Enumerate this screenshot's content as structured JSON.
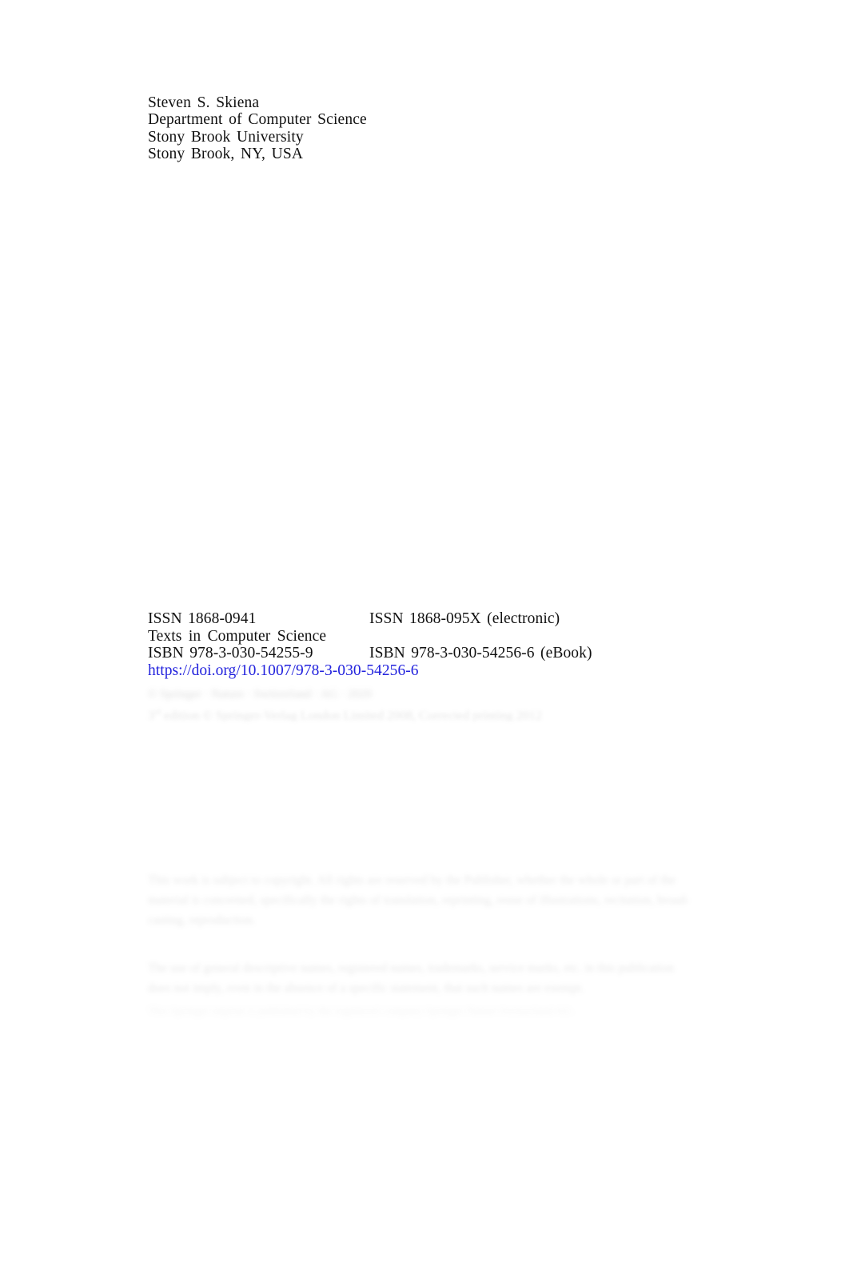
{
  "page": {
    "kind": "book-copyright-page",
    "background_color": "#ffffff",
    "text_color": "#111111",
    "link_color": "#2222dd",
    "blurred_text_color": "#8a8a8a"
  },
  "author": {
    "name": "Steven  S.  Skiena",
    "department": "Department  of  Computer  Science",
    "institution": "Stony  Brook  University",
    "location": "Stony  Brook,  NY,  USA"
  },
  "identifiers": {
    "issn_print_label": "ISSN",
    "issn_print_value": "1868-0941",
    "issn_electronic_label": "ISSN",
    "issn_electronic_value": "1868-095X",
    "issn_electronic_suffix": "(electronic)",
    "issn_print": "ISSN   1868-0941",
    "issn_electronic": "ISSN   1868-095X   (electronic)",
    "series": "Texts  in  Computer  Science",
    "isbn_print": "ISBN  978-3-030-54255-9",
    "isbn_ebook": "ISBN  978-3-030-54256-6   (eBook)",
    "doi_url": "https://doi.org/10.1007/978-3-030-54256-6"
  },
  "blurred": {
    "note": "illegible blurred text in source screenshot",
    "copyright_line": "© Springer · Nature · Switzerland · AG · 2020",
    "edition_line": "edition © Springer-Verlag London Limited 2008, Corrected printing 2012",
    "edition_superscript": "rd",
    "edition_number": "3",
    "paragraph_1": [
      "This work is subject to copyright. All rights are reserved by the Publisher, whether the whole or part of the",
      "material is concerned, specifically the rights of translation, reprinting, reuse of illustrations, recitation, broad-",
      "casting, reproduction."
    ],
    "paragraph_2": [
      "The use of general descriptive names, registered names, trademarks, service marks, etc. in this publication",
      "does not imply, even in the absence of a specific statement, that such names are exempt."
    ],
    "tail_line": "This Springer imprint is published by the registered company Springer Nature Switzerland AG."
  }
}
